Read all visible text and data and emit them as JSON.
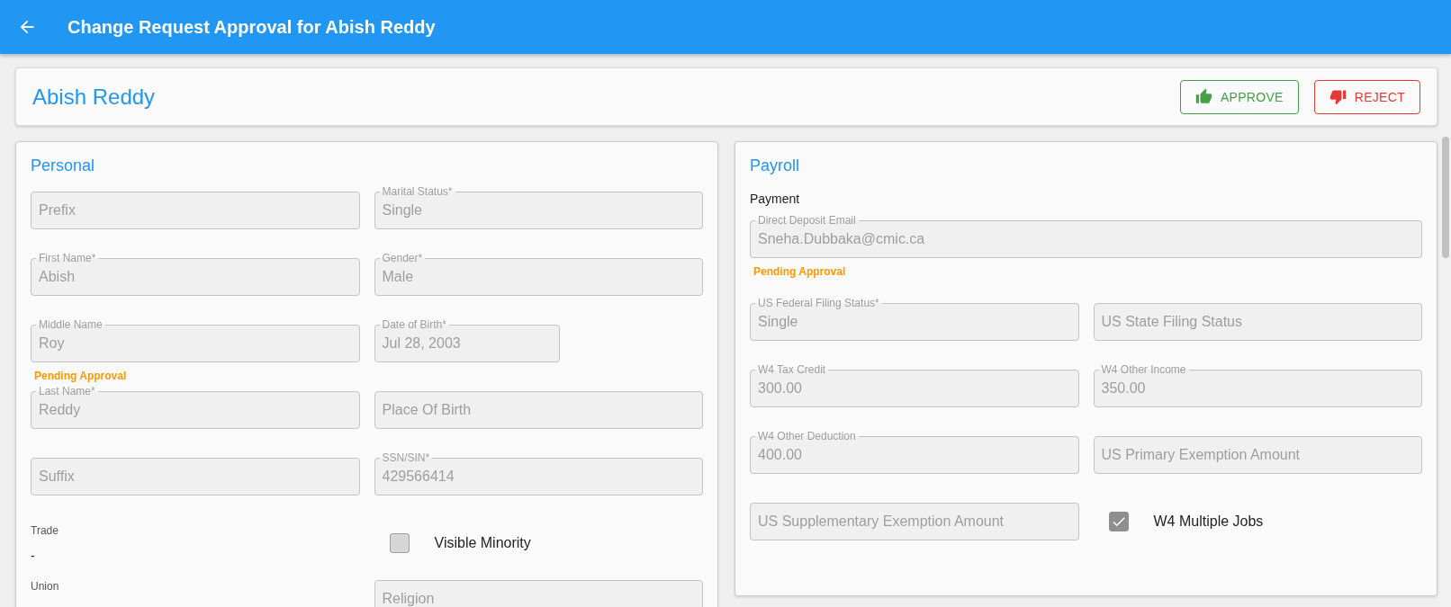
{
  "app_bar": {
    "title": "Change Request Approval for Abish Reddy"
  },
  "header": {
    "name": "Abish Reddy",
    "actions": [
      {
        "label": "APPROVE",
        "kind": "approve"
      },
      {
        "label": "REJECT",
        "kind": "reject"
      }
    ]
  },
  "sections": [
    {
      "title": "Personal",
      "items": [
        {
          "kind": "field",
          "placeholder": "Prefix"
        },
        {
          "kind": "field",
          "label": "Marital Status*",
          "value": "Single"
        },
        {
          "kind": "field",
          "label": "First Name*",
          "value": "Abish"
        },
        {
          "kind": "field",
          "label": "Gender*",
          "value": "Male"
        },
        {
          "kind": "field",
          "label": "Middle Name",
          "value": "Roy",
          "note": "Pending Approval"
        },
        {
          "kind": "date",
          "label": "Date of Birth*",
          "value": "Jul 28, 2003"
        },
        {
          "kind": "field",
          "label": "Last Name*",
          "value": "Reddy"
        },
        {
          "kind": "field",
          "placeholder": "Place Of Birth"
        },
        {
          "kind": "field",
          "placeholder": "Suffix"
        },
        {
          "kind": "field",
          "label": "SSN/SIN*",
          "value": "429566414"
        },
        {
          "kind": "static",
          "label": "Trade",
          "value": "-"
        },
        {
          "kind": "checkbox",
          "label": "Visible Minority",
          "checked": false
        },
        {
          "kind": "static",
          "label": "Union"
        },
        {
          "kind": "field",
          "placeholder": "Religion"
        }
      ]
    },
    {
      "title": "Payroll",
      "subheading": "Payment",
      "items": [
        {
          "kind": "wide",
          "label": "Direct Deposit Email",
          "value": "Sneha.Dubbaka@cmic.ca",
          "note": "Pending Approval"
        },
        {
          "kind": "field",
          "label": "US Federal Filing Status*",
          "value": "Single"
        },
        {
          "kind": "field",
          "placeholder": "US State Filing Status"
        },
        {
          "kind": "field",
          "label": "W4 Tax Credit",
          "value": "300.00"
        },
        {
          "kind": "field",
          "label": "W4 Other Income",
          "value": "350.00"
        },
        {
          "kind": "field",
          "label": "W4 Other Deduction",
          "value": "400.00"
        },
        {
          "kind": "field",
          "placeholder": "US Primary Exemption Amount"
        },
        {
          "kind": "field",
          "placeholder": "US Supplementary Exemption Amount"
        },
        {
          "kind": "checkbox",
          "label": "W4 Multiple Jobs",
          "checked": true
        }
      ]
    }
  ]
}
